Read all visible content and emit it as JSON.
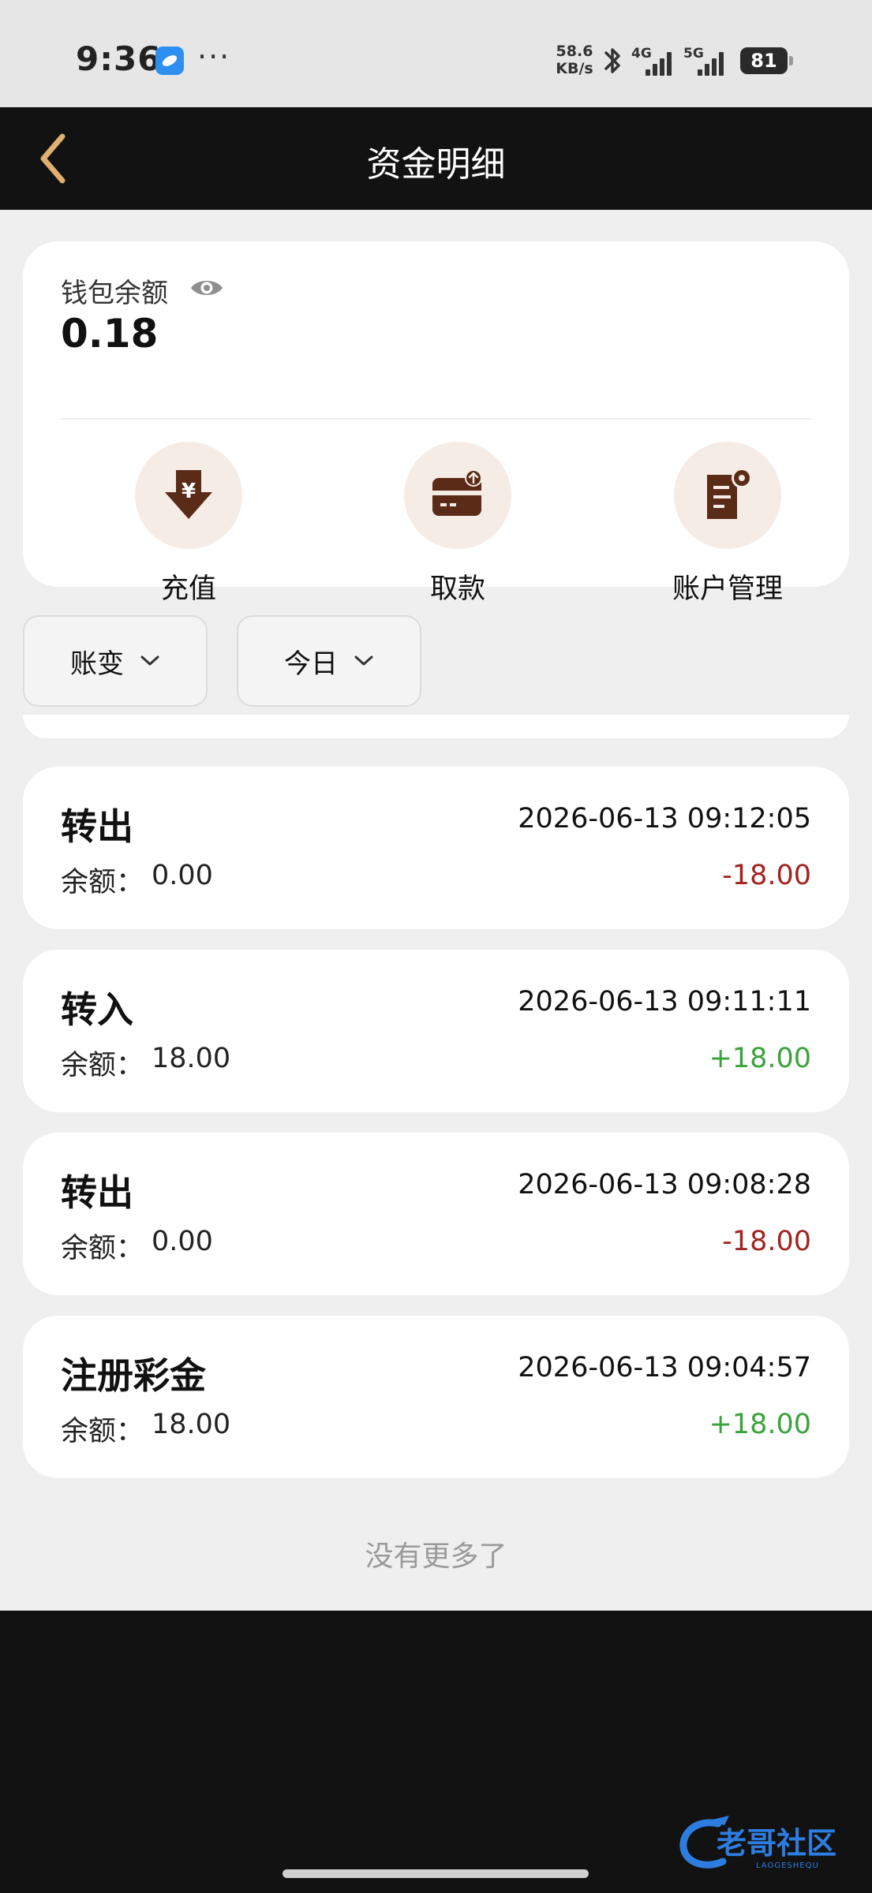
{
  "status_bar": {
    "time": "9:36",
    "more": "···",
    "net_speed_value": "58.6",
    "net_speed_unit": "KB/s",
    "sim1": "4G",
    "sim2": "5G",
    "battery": "81"
  },
  "header": {
    "title": "资金明细",
    "back_icon": "chevron-left-icon",
    "back_color": "#e0b070"
  },
  "wallet": {
    "label": "钱包余额",
    "balance": "0.18",
    "eye_icon": "eye-icon",
    "actions": [
      {
        "label": "充值",
        "icon": "deposit-icon"
      },
      {
        "label": "取款",
        "icon": "withdraw-card-icon"
      },
      {
        "label": "账户管理",
        "icon": "account-settings-icon"
      }
    ],
    "icon_color": "#5a2b17",
    "icon_bg": "#f6ece6"
  },
  "filters": [
    {
      "label": "账变",
      "icon": "chevron-down-icon"
    },
    {
      "label": "今日",
      "icon": "chevron-down-icon"
    }
  ],
  "transactions": [
    {
      "type": "转出",
      "time": "2026-06-13 09:12:05",
      "balance_label": "余额：",
      "balance": "0.00",
      "amount": "-18.00",
      "amount_color": "#a3231f"
    },
    {
      "type": "转入",
      "time": "2026-06-13 09:11:11",
      "balance_label": "余额：",
      "balance": "18.00",
      "amount": "+18.00",
      "amount_color": "#3aa33a"
    },
    {
      "type": "转出",
      "time": "2026-06-13 09:08:28",
      "balance_label": "余额：",
      "balance": "0.00",
      "amount": "-18.00",
      "amount_color": "#a3231f"
    },
    {
      "type": "注册彩金",
      "time": "2026-06-13 09:04:57",
      "balance_label": "余额：",
      "balance": "18.00",
      "amount": "+18.00",
      "amount_color": "#3aa33a"
    }
  ],
  "footer": {
    "no_more": "没有更多了"
  },
  "watermark": {
    "text": "老哥社区",
    "subtext": "LAOGESHEQU"
  }
}
